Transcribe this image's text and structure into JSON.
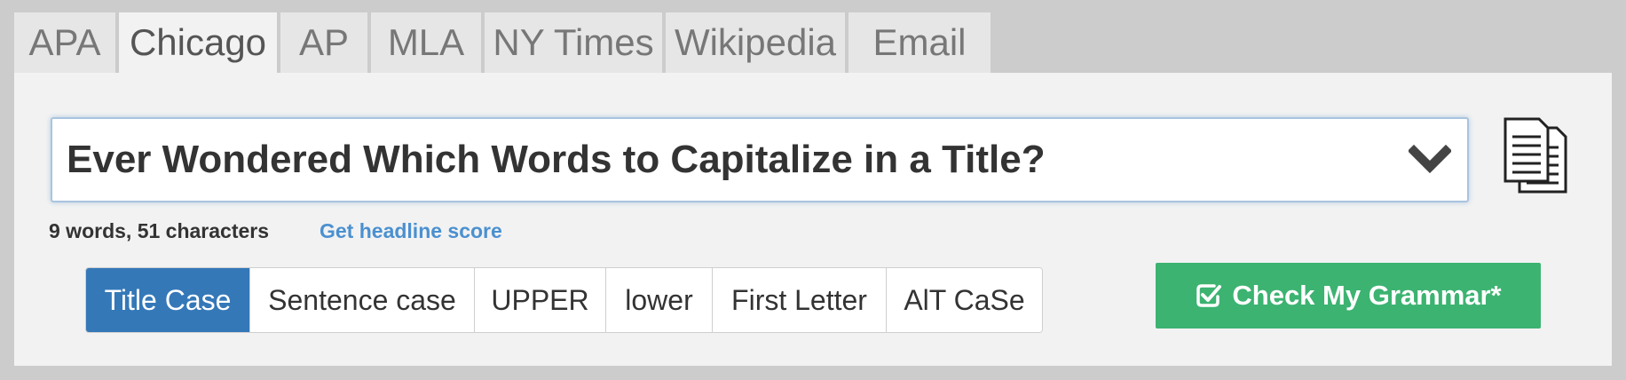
{
  "tabs": [
    {
      "label": "APA",
      "active": false
    },
    {
      "label": "Chicago",
      "active": true
    },
    {
      "label": "AP",
      "active": false
    },
    {
      "label": "MLA",
      "active": false
    },
    {
      "label": "NY Times",
      "active": false
    },
    {
      "label": "Wikipedia",
      "active": false
    },
    {
      "label": "Email",
      "active": false
    }
  ],
  "title_input": {
    "value": "Ever Wondered Which Words to Capitalize in a Title?"
  },
  "stats": {
    "text": "9 words, 51 characters"
  },
  "headline_link": {
    "label": "Get headline score"
  },
  "case_buttons": [
    {
      "label": "Title Case",
      "active": true
    },
    {
      "label": "Sentence case",
      "active": false
    },
    {
      "label": "UPPER",
      "active": false
    },
    {
      "label": "lower",
      "active": false
    },
    {
      "label": "First Letter",
      "active": false
    },
    {
      "label": "AlT CaSe",
      "active": false
    }
  ],
  "grammar_button": {
    "label": "Check My Grammar*"
  },
  "colors": {
    "active_case": "#3478b8",
    "grammar_green": "#3cb371",
    "link_blue": "#4a90d0"
  },
  "icons": {
    "dropdown": "chevron-down-icon",
    "copy": "copy-icon",
    "check": "check-square-icon"
  }
}
